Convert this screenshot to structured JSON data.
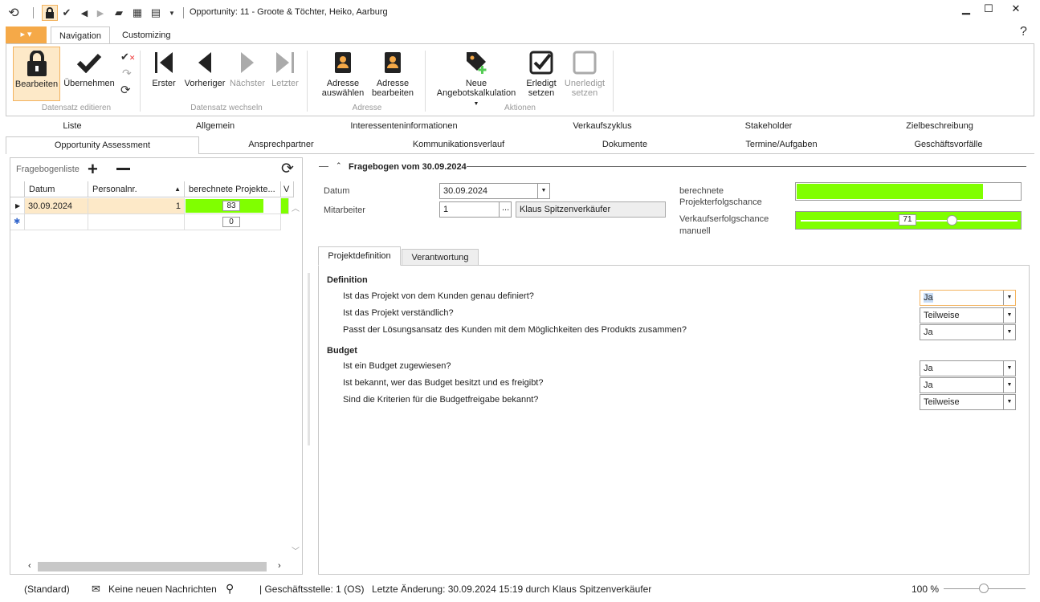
{
  "window": {
    "title": "Opportunity: 11 - Groote & Töchter, Heiko, Aarburg"
  },
  "ribbon_tabs": {
    "app_label": "▸ ▾",
    "navigation": "Navigation",
    "customizing": "Customizing"
  },
  "ribbon": {
    "edit": "Bearbeiten",
    "accept": "Übernehmen",
    "group_edit": "Datensatz editieren",
    "first": "Erster",
    "previous": "Vorheriger",
    "next": "Nächster",
    "last": "Letzter",
    "group_switch": "Datensatz wechseln",
    "select_address_1": "Adresse",
    "select_address_2": "auswählen",
    "edit_address_1": "Adresse",
    "edit_address_2": "bearbeiten",
    "group_address": "Adresse",
    "new_calc_1": "Neue",
    "new_calc_2": "Angebotskalkulation",
    "done_1": "Erledigt",
    "done_2": "setzen",
    "undone_1": "Unerledigt",
    "undone_2": "setzen",
    "group_actions": "Aktionen"
  },
  "nav_tabs_row1": [
    "Liste",
    "Allgemein",
    "Interessenteninformationen",
    "Verkaufszyklus",
    "Stakeholder",
    "Zielbeschreibung"
  ],
  "nav_tabs_row2": [
    "Opportunity Assessment",
    "Ansprechpartner",
    "Kommunikationsverlauf",
    "Dokumente",
    "Termine/Aufgaben",
    "Geschäftsvorfälle"
  ],
  "left": {
    "title": "Fragebogenliste",
    "columns": [
      "Datum",
      "Personalnr.",
      "berechnete Projekte...",
      "V"
    ],
    "rows": [
      {
        "date": "30.09.2024",
        "personal": "1",
        "chance": "83"
      }
    ],
    "new_row_chance": "0"
  },
  "right": {
    "section_title": "Fragebogen vom 30.09.2024",
    "date_label": "Datum",
    "date_value": "30.09.2024",
    "employee_label": "Mitarbeiter",
    "employee_value": "1",
    "employee_name": "Klaus Spitzenverkäufer",
    "calc_label_1": "berechnete",
    "calc_label_2": "Projekterfolgschance",
    "calc_value": 83,
    "manual_label_1": "Verkaufserfolgschance",
    "manual_label_2": "manuell",
    "manual_value": "71",
    "tab_active": "Projektdefinition",
    "tab_other": "Verantwortung",
    "definition_title": "Definition",
    "q1": "Ist das Projekt von dem Kunden genau definiert?",
    "a1": "Ja",
    "q2": "Ist das Projekt verständlich?",
    "a2": "Teilweise",
    "q3": "Passt der Lösungsansatz des Kunden mit dem Möglichkeiten des Produkts zusammen?",
    "a3": "Ja",
    "budget_title": "Budget",
    "q4": "Ist ein Budget zugewiesen?",
    "a4": "Ja",
    "q5": "Ist bekannt, wer das Budget besitzt und es freigibt?",
    "a5": "Ja",
    "q6": "Sind die Kriterien für die Budgetfreigabe bekannt?",
    "a6": "Teilweise"
  },
  "status": {
    "standard": "(Standard)",
    "messages": "Keine neuen Nachrichten",
    "branch": "| Geschäftsstelle:  1 (OS)",
    "last_change": "Letzte Änderung: 30.09.2024 15:19 durch Klaus Spitzenverkäufer",
    "zoom": "100 %"
  },
  "colors": {
    "accent_orange": "#f5a948",
    "success_green": "#80ff00"
  }
}
